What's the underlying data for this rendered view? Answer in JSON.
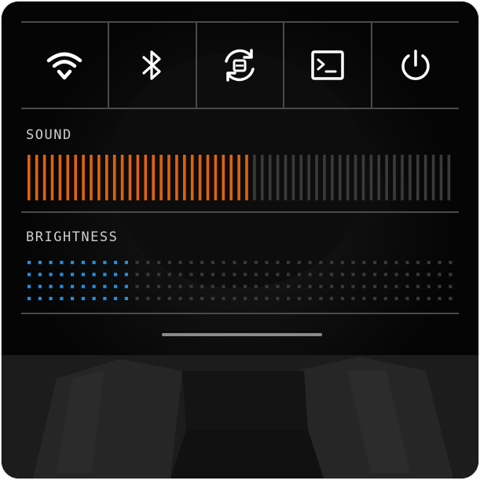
{
  "toggles": [
    {
      "name": "wifi",
      "icon": "wifi-icon"
    },
    {
      "name": "bluetooth",
      "icon": "bluetooth-icon"
    },
    {
      "name": "rotation-lock",
      "icon": "rotate-lock-icon"
    },
    {
      "name": "terminal",
      "icon": "terminal-icon"
    },
    {
      "name": "power",
      "icon": "power-icon"
    }
  ],
  "sound": {
    "label": "SOUND",
    "level_fraction": 0.52,
    "active_color": "#e0620e",
    "inactive_color": "#3a3a3a"
  },
  "brightness": {
    "label": "BRIGHTNESS",
    "level_fraction": 0.26,
    "active_color": "#1e90e6",
    "inactive_color": "#383838"
  },
  "colors": {
    "panel_bg": "#050505",
    "divider": "#4a4a4a",
    "icon": "#ffffff",
    "label_text": "#cfcfcf"
  }
}
